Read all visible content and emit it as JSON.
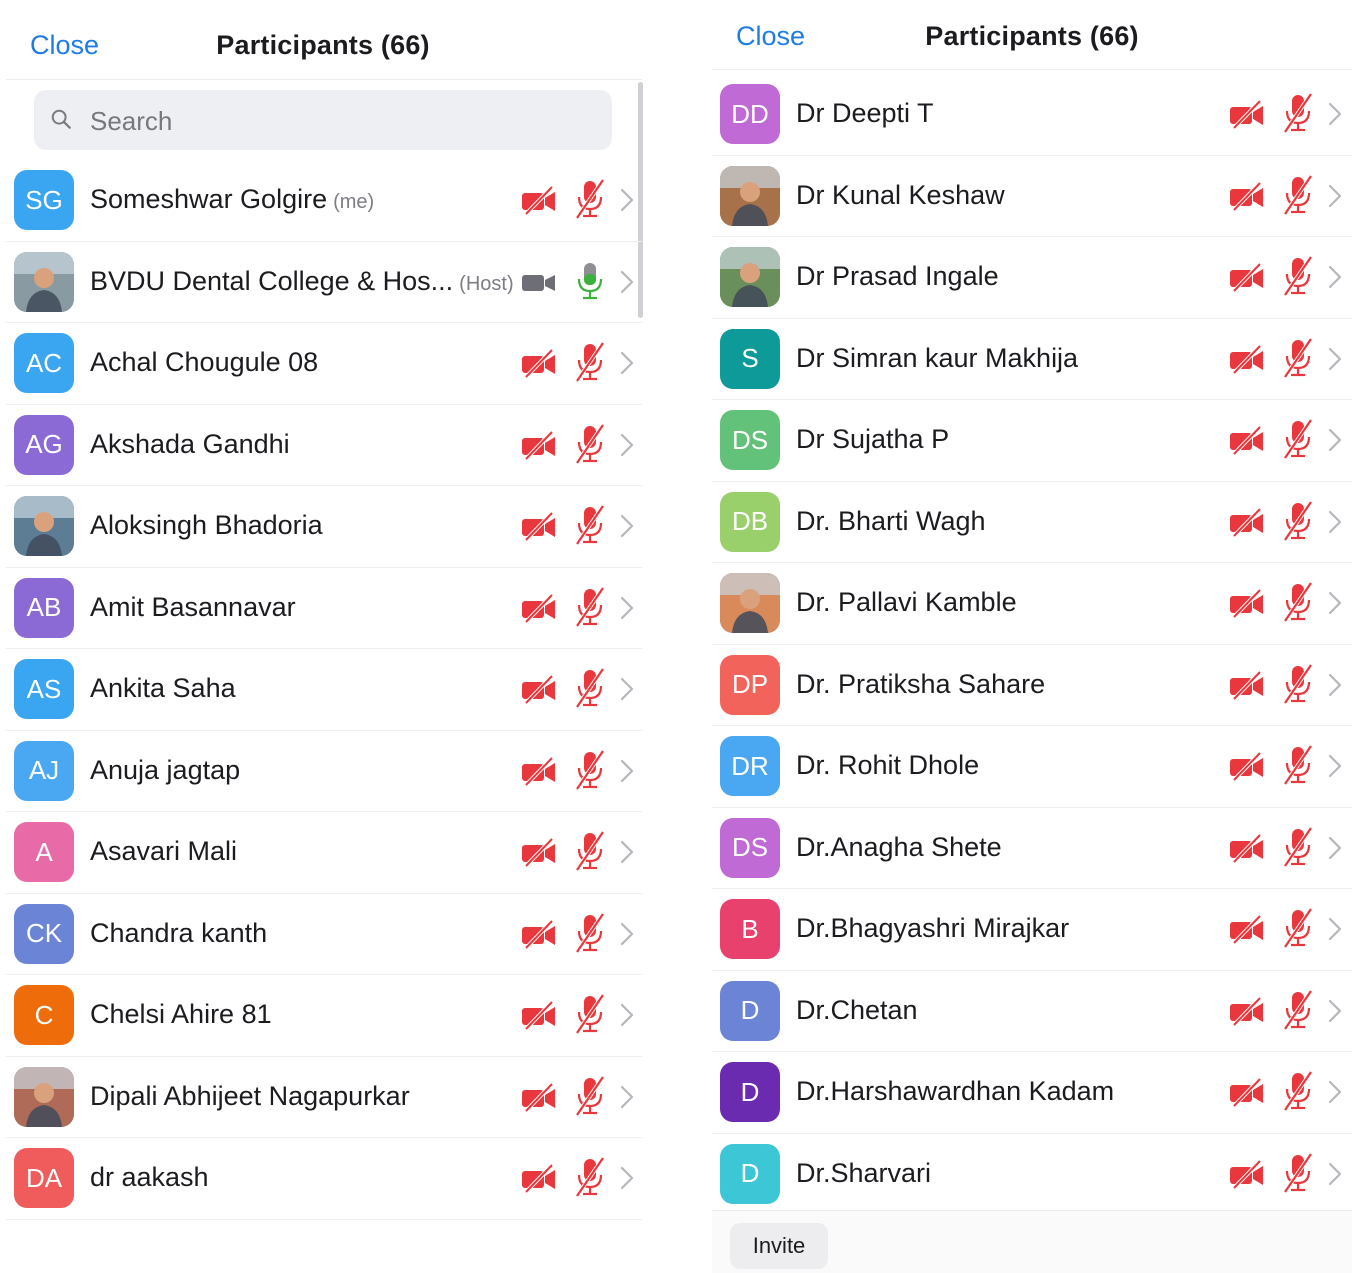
{
  "left_panel": {
    "close_label": "Close",
    "title": "Participants (66)",
    "search_placeholder": "Search",
    "participants": [
      {
        "initials": "SG",
        "name": "Someshwar Golgire",
        "tag": "(me)",
        "color": "#3aa5f0",
        "photo": false,
        "video": "off",
        "audio": "muted"
      },
      {
        "initials": "",
        "name": "BVDU Dental College & Hos...",
        "tag": "(Host)",
        "color": "#8a9aa3",
        "photo": true,
        "video": "on",
        "audio": "on"
      },
      {
        "initials": "AC",
        "name": "Achal Chougule 08",
        "tag": "",
        "color": "#3aa5f0",
        "photo": false,
        "video": "off",
        "audio": "muted"
      },
      {
        "initials": "AG",
        "name": "Akshada Gandhi",
        "tag": "",
        "color": "#8b6ad6",
        "photo": false,
        "video": "off",
        "audio": "muted"
      },
      {
        "initials": "",
        "name": "Aloksingh Bhadoria",
        "tag": "",
        "color": "#5d7d94",
        "photo": true,
        "video": "off",
        "audio": "muted"
      },
      {
        "initials": "AB",
        "name": "Amit Basannavar",
        "tag": "",
        "color": "#8b6ad6",
        "photo": false,
        "video": "off",
        "audio": "muted"
      },
      {
        "initials": "AS",
        "name": "Ankita Saha",
        "tag": "",
        "color": "#3aa5f0",
        "photo": false,
        "video": "off",
        "audio": "muted"
      },
      {
        "initials": "AJ",
        "name": "Anuja jagtap",
        "tag": "",
        "color": "#4aa8f2",
        "photo": false,
        "video": "off",
        "audio": "muted"
      },
      {
        "initials": "A",
        "name": "Asavari  Mali",
        "tag": "",
        "color": "#e86ba8",
        "photo": false,
        "video": "off",
        "audio": "muted"
      },
      {
        "initials": "CK",
        "name": "Chandra kanth",
        "tag": "",
        "color": "#6b84d6",
        "photo": false,
        "video": "off",
        "audio": "muted"
      },
      {
        "initials": "C",
        "name": "Chelsi Ahire 81",
        "tag": "",
        "color": "#ef6c0b",
        "photo": false,
        "video": "off",
        "audio": "muted"
      },
      {
        "initials": "",
        "name": "Dipali Abhijeet Nagapurkar",
        "tag": "",
        "color": "#b06a58",
        "photo": true,
        "video": "off",
        "audio": "muted"
      },
      {
        "initials": "DA",
        "name": "dr aakash",
        "tag": "",
        "color": "#f05b5b",
        "photo": false,
        "video": "off",
        "audio": "muted"
      }
    ]
  },
  "right_panel": {
    "close_label": "Close",
    "title": "Participants (66)",
    "invite_label": "Invite",
    "participants": [
      {
        "initials": "DD",
        "name": "Dr Deepti T",
        "color": "#c06ad6",
        "photo": false,
        "video": "off",
        "audio": "muted"
      },
      {
        "initials": "",
        "name": "Dr Kunal Keshaw",
        "color": "#a7714a",
        "photo": true,
        "video": "off",
        "audio": "muted"
      },
      {
        "initials": "",
        "name": "Dr Prasad Ingale",
        "color": "#6b8f5a",
        "photo": true,
        "video": "off",
        "audio": "muted"
      },
      {
        "initials": "S",
        "name": "Dr Simran kaur Makhija",
        "color": "#0f9a9a",
        "photo": false,
        "video": "off",
        "audio": "muted"
      },
      {
        "initials": "DS",
        "name": "Dr Sujatha P",
        "color": "#63c27a",
        "photo": false,
        "video": "off",
        "audio": "muted"
      },
      {
        "initials": "DB",
        "name": "Dr. Bharti Wagh",
        "color": "#9ad06c",
        "photo": false,
        "video": "off",
        "audio": "muted"
      },
      {
        "initials": "",
        "name": "Dr. Pallavi Kamble",
        "color": "#d88a5a",
        "photo": true,
        "video": "off",
        "audio": "muted"
      },
      {
        "initials": "DP",
        "name": "Dr. Pratiksha Sahare",
        "color": "#f2635c",
        "photo": false,
        "video": "off",
        "audio": "muted"
      },
      {
        "initials": "DR",
        "name": "Dr. Rohit Dhole",
        "color": "#4aa8f2",
        "photo": false,
        "video": "off",
        "audio": "muted"
      },
      {
        "initials": "DS",
        "name": "Dr.Anagha Shete",
        "color": "#c06ad6",
        "photo": false,
        "video": "off",
        "audio": "muted"
      },
      {
        "initials": "B",
        "name": "Dr.Bhagyashri Mirajkar",
        "color": "#e8416d",
        "photo": false,
        "video": "off",
        "audio": "muted"
      },
      {
        "initials": "D",
        "name": "Dr.Chetan",
        "color": "#6b84d6",
        "photo": false,
        "video": "off",
        "audio": "muted"
      },
      {
        "initials": "D",
        "name": "Dr.Harshawardhan Kadam",
        "color": "#6a2bb0",
        "photo": false,
        "video": "off",
        "audio": "muted"
      },
      {
        "initials": "D",
        "name": "Dr.Sharvari",
        "color": "#3cc6d6",
        "photo": false,
        "video": "off",
        "audio": "muted"
      }
    ]
  },
  "icons": {
    "search": "search-icon",
    "video_off": "video-off-icon",
    "video_on": "video-on-icon",
    "mic_muted": "mic-muted-icon",
    "mic_on": "mic-on-icon",
    "chevron": "chevron-right-icon"
  },
  "colors": {
    "accent": "#1e7ce3",
    "muted_red": "#e8383d",
    "mic_on_green": "#3db13d",
    "video_on_gray": "#6e6e76"
  }
}
